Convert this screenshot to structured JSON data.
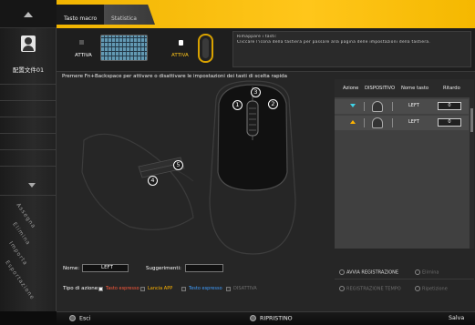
{
  "sidebar": {
    "profile_label": "配置文件01",
    "side_tabs": [
      "Assegna",
      "Elimina",
      "Importa",
      "Esportazione"
    ]
  },
  "tabs": [
    {
      "label": "Tasto macro",
      "active": true
    },
    {
      "label": "Statistica",
      "active": false
    }
  ],
  "devices": {
    "keyboard_label": "ATTIVA",
    "mouse_label": "ATTIVA"
  },
  "info": {
    "line1": "Rimappare i tasti:",
    "line2": "Cliccare l'icona della tastiera per passare alla pagina delle impostazioni della tastiera."
  },
  "main": {
    "instruction": "Premere Fn+Backspace per attivare o disattivare le impostazioni dei tasti di scelta rapida",
    "callouts": [
      "1",
      "3",
      "2",
      "5",
      "4"
    ]
  },
  "table": {
    "headers": [
      "Azione",
      "DISPOSITIVO",
      "Nome tasto",
      "Ritardo"
    ],
    "rows": [
      {
        "action": "down",
        "key": "LEFT",
        "delay": "0"
      },
      {
        "action": "up",
        "key": "LEFT",
        "delay": "0"
      }
    ]
  },
  "form": {
    "name_label": "Nome:",
    "name_value": "LEFT",
    "suggest_label": "Suggerimenti:",
    "suggest_value": "",
    "action_type_label": "Tipo di azione:",
    "options": [
      {
        "label": "Tasto espresso",
        "checked": true,
        "color": "#ff5a3c"
      },
      {
        "label": "Lancia APP",
        "checked": false,
        "color": "#ffb400"
      },
      {
        "label": "Testo espresso",
        "checked": false,
        "color": "#3f9dff"
      },
      {
        "label": "DISATTIVA",
        "checked": false,
        "color": "#6d6d6d"
      }
    ],
    "buttons": {
      "record": "AVVIA REGISTRAZIONE",
      "delete": "Elimina",
      "record_time": "REGISTRAZIONE TEMPO",
      "repeat": "Ripetizione"
    }
  },
  "footer": {
    "exit": "Esci",
    "reset": "RIPRISTINO",
    "save": "Salva"
  },
  "colors": {
    "accent": "#ffc61a",
    "cyan": "#3fd3e6",
    "orange": "#ffb400"
  }
}
